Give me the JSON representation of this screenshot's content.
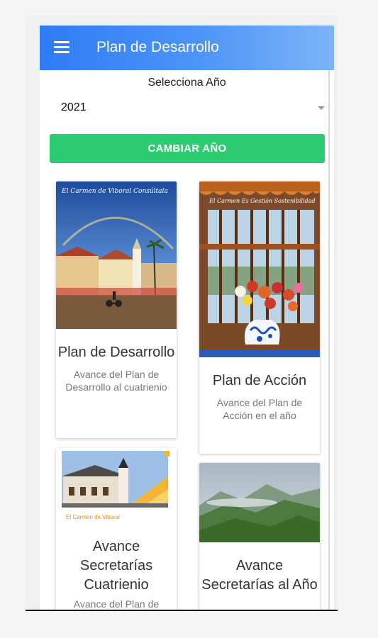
{
  "app": {
    "title": "Plan de Desarrollo",
    "menu_icon": "hamburger-menu-icon"
  },
  "year_selector": {
    "label": "Selecciona Año",
    "selected": "2021",
    "button": "CAMBIAR AÑO"
  },
  "colors": {
    "appbar_start": "#2e7cf6",
    "appbar_end": "#7db4f9",
    "button_green": "#2ecc71"
  },
  "cards": [
    {
      "title": "Plan de Desarrollo",
      "description": "Avance del Plan de Desarrollo al cuatrienio",
      "image_overlay": "El Carmen de Viboral Consúltala",
      "image": "town-plaza-church-photo"
    },
    {
      "title": "Plan de Acción",
      "description": "Avance del Plan de Acción en el año",
      "image_overlay": "El Carmen Es Gestión Sostenibilidad",
      "image": "flower-vase-balcony-photo"
    },
    {
      "title": "Avance Secretarías Cuatrienio",
      "description": "Avance del Plan de",
      "image_overlay": "El Carmen de Viboral",
      "image": "municipal-building-banner"
    },
    {
      "title": "Avance Secretarías al Año",
      "description": "",
      "image": "green-mountains-photo"
    }
  ]
}
